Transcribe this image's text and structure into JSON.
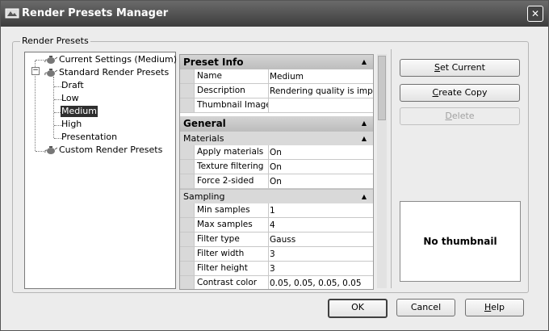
{
  "window": {
    "title": "Render Presets Manager",
    "close_glyph": "✕"
  },
  "group": {
    "label": "Render Presets"
  },
  "tree": {
    "current": "Current Settings (Medium)",
    "standard": "Standard Render Presets",
    "standard_items": [
      "Draft",
      "Low",
      "Medium",
      "High",
      "Presentation"
    ],
    "custom": "Custom Render Presets",
    "selected": "Medium"
  },
  "props": {
    "preset_info": {
      "title": "Preset Info",
      "rows": [
        {
          "name": "Name",
          "value": "Medium"
        },
        {
          "name": "Description",
          "value": "Rendering quality is imp..."
        },
        {
          "name": "Thumbnail Image",
          "value": ""
        }
      ]
    },
    "general": {
      "title": "General",
      "materials": {
        "title": "Materials",
        "rows": [
          {
            "name": "Apply materials",
            "value": "On"
          },
          {
            "name": "Texture filtering",
            "value": "On"
          },
          {
            "name": "Force 2-sided",
            "value": "On"
          }
        ]
      },
      "sampling": {
        "title": "Sampling",
        "rows": [
          {
            "name": "Min samples",
            "value": "1"
          },
          {
            "name": "Max samples",
            "value": "4"
          },
          {
            "name": "Filter type",
            "value": "Gauss"
          },
          {
            "name": "Filter width",
            "value": "3"
          },
          {
            "name": "Filter height",
            "value": "3"
          },
          {
            "name": "Contrast color",
            "value": "0.05, 0.05, 0.05, 0.05"
          }
        ]
      }
    }
  },
  "buttons": {
    "set_current": {
      "mnemonic": "S",
      "rest": "et Current"
    },
    "create_copy": {
      "mnemonic": "C",
      "rest": "reate Copy"
    },
    "delete": {
      "mnemonic": "D",
      "rest": "elete"
    },
    "ok": "OK",
    "cancel": "Cancel",
    "help": {
      "mnemonic": "H",
      "rest": "elp"
    }
  },
  "thumbnail": {
    "text": "No thumbnail"
  }
}
